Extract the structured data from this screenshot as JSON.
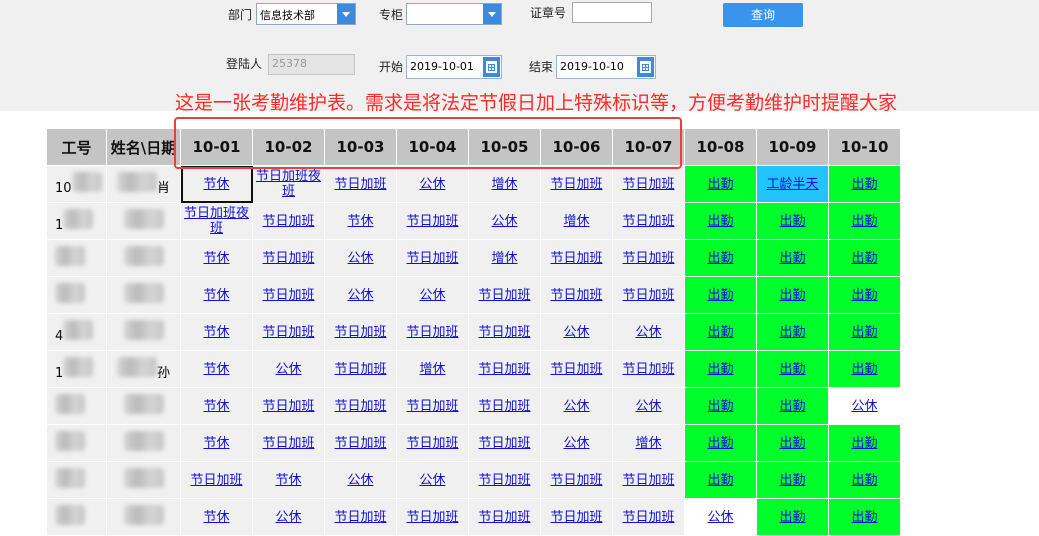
{
  "filters": {
    "dept_label": "部门",
    "dept_value": "信息技术部",
    "counter_label": "专柜",
    "counter_value": "",
    "badge_label": "证章号",
    "badge_value": "",
    "query_button": "查询",
    "login_label": "登陆人",
    "login_value": "25378",
    "start_label": "开始",
    "start_value": "2019-10-01",
    "end_label": "结束",
    "end_value": "2019-10-10"
  },
  "annotation": "这是一张考勤维护表。需求是将法定节假日加上特殊标识等，方便考勤维护时提醒大家",
  "table": {
    "headers": [
      "工号",
      "姓名\\日期",
      "10-01",
      "10-02",
      "10-03",
      "10-04",
      "10-05",
      "10-06",
      "10-07",
      "10-08",
      "10-09",
      "10-10"
    ],
    "rows": [
      {
        "id": "10",
        "name": "肖",
        "cells": [
          {
            "text": "节休",
            "style": "sel"
          },
          {
            "text": "节日加班夜班"
          },
          {
            "text": "节日加班"
          },
          {
            "text": "公休"
          },
          {
            "text": "增休"
          },
          {
            "text": "节日加班"
          },
          {
            "text": "节日加班"
          },
          {
            "text": "出勤",
            "style": "green"
          },
          {
            "text": "工龄半天",
            "style": "blue"
          },
          {
            "text": "出勤",
            "style": "green"
          }
        ]
      },
      {
        "id": "1",
        "name": "",
        "cells": [
          {
            "text": "节日加班夜班"
          },
          {
            "text": "节日加班"
          },
          {
            "text": "节休"
          },
          {
            "text": "节日加班"
          },
          {
            "text": "公休"
          },
          {
            "text": "增休"
          },
          {
            "text": "节日加班"
          },
          {
            "text": "出勤",
            "style": "green"
          },
          {
            "text": "出勤",
            "style": "green"
          },
          {
            "text": "出勤",
            "style": "green"
          }
        ]
      },
      {
        "id": "",
        "name": "",
        "cells": [
          {
            "text": "节休"
          },
          {
            "text": "节日加班"
          },
          {
            "text": "公休"
          },
          {
            "text": "节日加班"
          },
          {
            "text": "增休"
          },
          {
            "text": "节日加班"
          },
          {
            "text": "节日加班"
          },
          {
            "text": "出勤",
            "style": "green"
          },
          {
            "text": "出勤",
            "style": "green"
          },
          {
            "text": "出勤",
            "style": "green"
          }
        ]
      },
      {
        "id": "",
        "name": "",
        "cells": [
          {
            "text": "节休"
          },
          {
            "text": "节日加班"
          },
          {
            "text": "公休"
          },
          {
            "text": "公休"
          },
          {
            "text": "节日加班"
          },
          {
            "text": "节日加班"
          },
          {
            "text": "节日加班"
          },
          {
            "text": "出勤",
            "style": "green"
          },
          {
            "text": "出勤",
            "style": "green"
          },
          {
            "text": "出勤",
            "style": "green"
          }
        ]
      },
      {
        "id": "4",
        "name": "",
        "cells": [
          {
            "text": "节休"
          },
          {
            "text": "节日加班"
          },
          {
            "text": "节日加班"
          },
          {
            "text": "节日加班"
          },
          {
            "text": "节日加班"
          },
          {
            "text": "公休"
          },
          {
            "text": "公休"
          },
          {
            "text": "出勤",
            "style": "green"
          },
          {
            "text": "出勤",
            "style": "green"
          },
          {
            "text": "出勤",
            "style": "green"
          }
        ]
      },
      {
        "id": "1",
        "name": "孙",
        "cells": [
          {
            "text": "节休"
          },
          {
            "text": "公休"
          },
          {
            "text": "节日加班"
          },
          {
            "text": "增休"
          },
          {
            "text": "节日加班"
          },
          {
            "text": "节日加班"
          },
          {
            "text": "节日加班"
          },
          {
            "text": "出勤",
            "style": "green"
          },
          {
            "text": "出勤",
            "style": "green"
          },
          {
            "text": "出勤",
            "style": "green"
          }
        ]
      },
      {
        "id": "",
        "name": "",
        "cells": [
          {
            "text": "节休"
          },
          {
            "text": "节日加班"
          },
          {
            "text": "节日加班"
          },
          {
            "text": "节日加班"
          },
          {
            "text": "节日加班"
          },
          {
            "text": "公休"
          },
          {
            "text": "公休"
          },
          {
            "text": "出勤",
            "style": "green"
          },
          {
            "text": "出勤",
            "style": "green"
          },
          {
            "text": "公休",
            "style": "white"
          }
        ]
      },
      {
        "id": "",
        "name": "",
        "cells": [
          {
            "text": "节休"
          },
          {
            "text": "节日加班"
          },
          {
            "text": "节日加班"
          },
          {
            "text": "节日加班"
          },
          {
            "text": "节日加班"
          },
          {
            "text": "公休"
          },
          {
            "text": "增休"
          },
          {
            "text": "出勤",
            "style": "green"
          },
          {
            "text": "出勤",
            "style": "green"
          },
          {
            "text": "出勤",
            "style": "green"
          }
        ]
      },
      {
        "id": "",
        "name": "",
        "cells": [
          {
            "text": "节日加班"
          },
          {
            "text": "节休"
          },
          {
            "text": "公休"
          },
          {
            "text": "公休"
          },
          {
            "text": "节日加班"
          },
          {
            "text": "节日加班"
          },
          {
            "text": "节日加班"
          },
          {
            "text": "出勤",
            "style": "green"
          },
          {
            "text": "出勤",
            "style": "green"
          },
          {
            "text": "出勤",
            "style": "green"
          }
        ]
      },
      {
        "id": "",
        "name": "",
        "cells": [
          {
            "text": "节休"
          },
          {
            "text": "公休"
          },
          {
            "text": "节日加班"
          },
          {
            "text": "节日加班"
          },
          {
            "text": "节日加班"
          },
          {
            "text": "节日加班"
          },
          {
            "text": "节日加班"
          },
          {
            "text": "公休",
            "style": "white"
          },
          {
            "text": "出勤",
            "style": "green"
          },
          {
            "text": "出勤",
            "style": "green"
          }
        ]
      }
    ]
  }
}
